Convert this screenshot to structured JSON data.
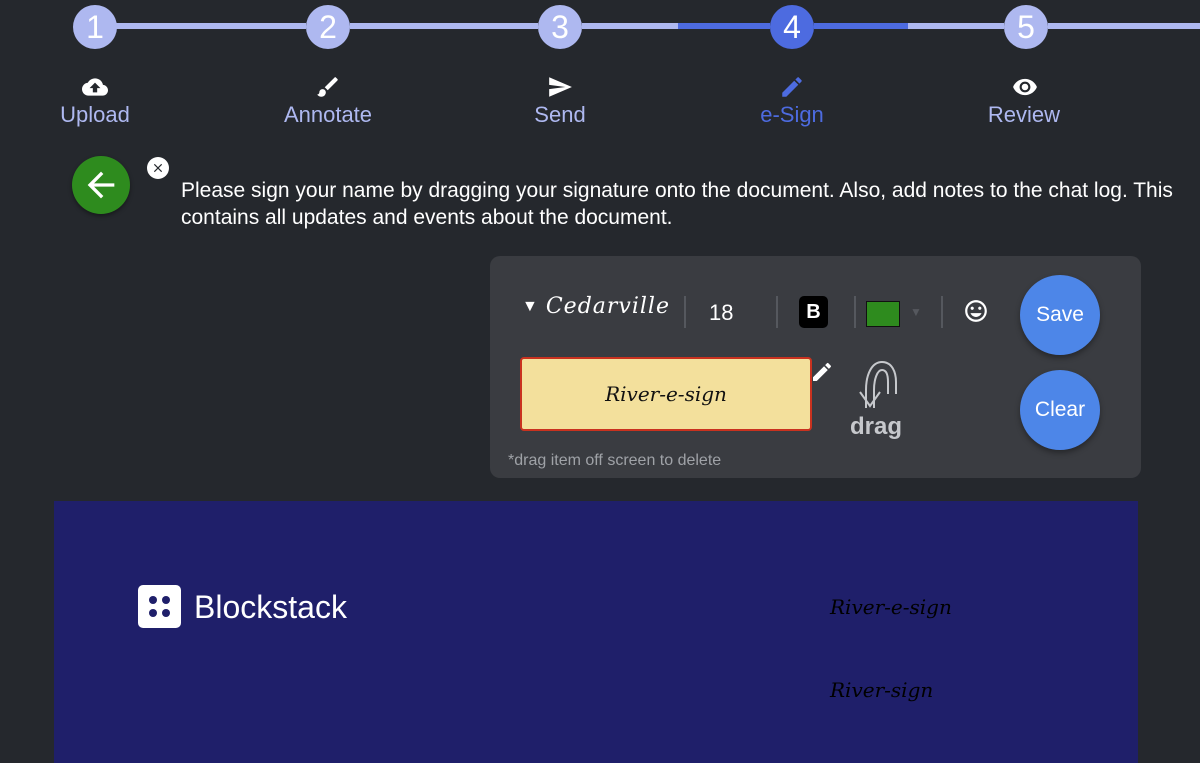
{
  "stepper": {
    "steps": [
      {
        "number": "1",
        "label": "Upload",
        "icon": "upload-cloud-icon"
      },
      {
        "number": "2",
        "label": "Annotate",
        "icon": "brush-icon"
      },
      {
        "number": "3",
        "label": "Send",
        "icon": "send-icon"
      },
      {
        "number": "4",
        "label": "e-Sign",
        "icon": "pencil-icon"
      },
      {
        "number": "5",
        "label": "Review",
        "icon": "eye-icon"
      }
    ],
    "active_step": 4
  },
  "instruction": {
    "text": "Please sign your name by dragging your signature onto the document. Also, add notes to the chat log. This contains all updates and events about the document."
  },
  "toolbar": {
    "font_name": "Cedarville",
    "font_size": "18",
    "bold_label": "B",
    "color": "#2e8b1e",
    "save_label": "Save",
    "clear_label": "Clear"
  },
  "signature": {
    "text": "River-e-sign",
    "drag_label": "drag",
    "hint": "*drag item off screen to delete"
  },
  "document": {
    "brand": "Blockstack",
    "placed_signatures": [
      "River-e-sign",
      "River-sign"
    ]
  },
  "colors": {
    "background": "#25282d",
    "panel": "#3a3c41",
    "accent_blue": "#4d86e8",
    "step_inactive": "#aeb8f0",
    "step_active": "#4d6be0",
    "back_button": "#2e8b1e",
    "document": "#1f1f6a",
    "signature_box": "#f3e09c",
    "signature_border": "#c9321f"
  }
}
